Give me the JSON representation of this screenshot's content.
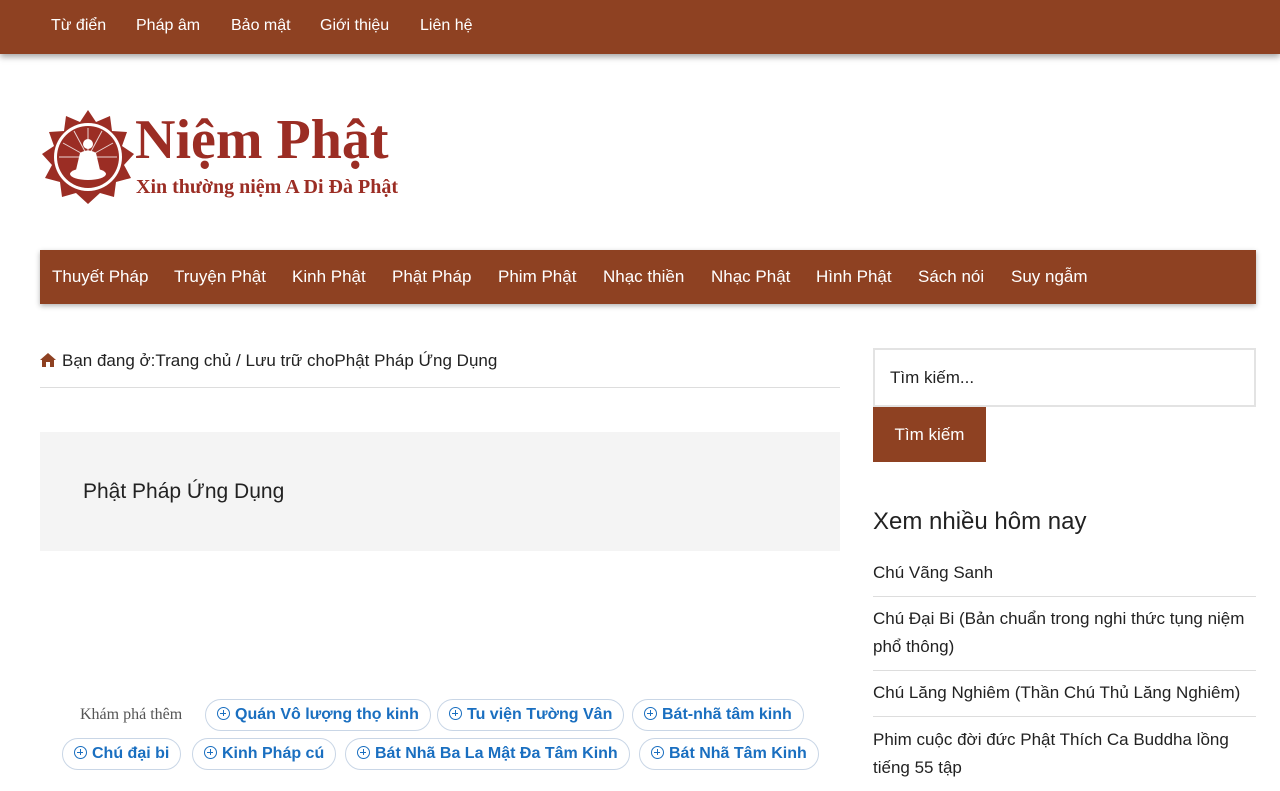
{
  "top_nav": [
    "Từ điển",
    "Pháp âm",
    "Bảo mật",
    "Giới thiệu",
    "Liên hệ"
  ],
  "site": {
    "title": "Niệm Phật",
    "tagline": "Xin thường niệm A Di Đà Phật"
  },
  "main_nav": [
    "Thuyết Pháp",
    "Truyện Phật",
    "Kinh Phật",
    "Phật Pháp",
    "Phim Phật",
    "Nhạc thiền",
    "Nhạc Phật",
    "Hình Phật",
    "Sách nói",
    "Suy ngẫm"
  ],
  "breadcrumb": {
    "prefix": "Bạn đang ở:",
    "home": "Trang chủ",
    "separator": " / ",
    "archive_label": "Lưu trữ cho",
    "current": "Phật Pháp Ứng Dụng"
  },
  "archive": {
    "title": "Phật Pháp Ứng Dụng"
  },
  "explore": {
    "label": "Khám phá thêm",
    "tags": [
      "Quán Vô lượng thọ kinh",
      "Tu viện Tường Vân",
      "Bát-nhã tâm kinh",
      "Chú đại bi",
      "Kinh Pháp cú",
      "Bát Nhã Ba La Mật Đa Tâm Kinh",
      "Bát Nhã Tâm Kinh"
    ]
  },
  "sidebar": {
    "search_placeholder": "Tìm kiếm...",
    "search_button": "Tìm kiếm",
    "popular_title": "Xem nhiều hôm nay",
    "popular": [
      "Chú Vãng Sanh",
      "Chú Đại Bi (Bản chuẩn trong nghi thức tụng niệm phổ thông)",
      "Chú Lăng Nghiêm (Thần Chú Thủ Lăng Nghiêm)",
      "Phim cuộc đời đức Phật Thích Ca Buddha lồng tiếng 55 tập"
    ]
  },
  "colors": {
    "brand": "#8e4122",
    "logo": "#9b2d24",
    "tag": "#1a6fc0"
  }
}
